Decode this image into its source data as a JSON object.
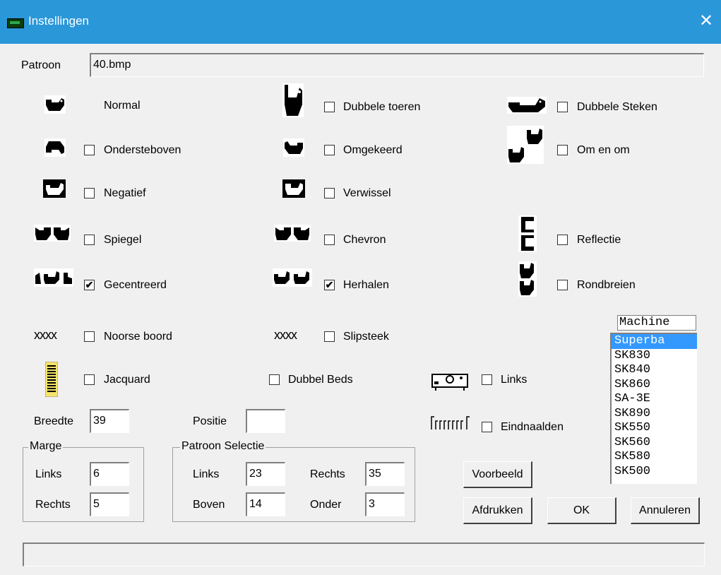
{
  "window": {
    "title": "Instellingen",
    "close": "✕"
  },
  "patroon": {
    "label": "Patroon",
    "value": "40.bmp"
  },
  "options": {
    "normal": {
      "label": "Normal"
    },
    "dubbele_toeren": {
      "label": "Dubbele toeren",
      "checked": false
    },
    "dubbele_steken": {
      "label": "Dubbele Steken",
      "checked": false
    },
    "ondersteboven": {
      "label": "Ondersteboven",
      "checked": false
    },
    "omgekeerd": {
      "label": "Omgekeerd",
      "checked": false
    },
    "om_en_om": {
      "label": "Om en om",
      "checked": false
    },
    "negatief": {
      "label": "Negatief",
      "checked": false
    },
    "verwissel": {
      "label": "Verwissel",
      "checked": false
    },
    "spiegel": {
      "label": "Spiegel",
      "checked": false
    },
    "chevron": {
      "label": "Chevron",
      "checked": false
    },
    "reflectie": {
      "label": "Reflectie",
      "checked": false
    },
    "gecentreerd": {
      "label": "Gecentreerd",
      "checked": true,
      "mark": "✔"
    },
    "herhalen": {
      "label": "Herhalen",
      "checked": true,
      "mark": "✔"
    },
    "rondbreien": {
      "label": "Rondbreien",
      "checked": false
    },
    "noorse_boord": {
      "label": "Noorse boord",
      "checked": false,
      "icon_text": "xxxx"
    },
    "slipsteek": {
      "label": "Slipsteek",
      "checked": false,
      "icon_text": "xxxx"
    },
    "jacquard": {
      "label": "Jacquard",
      "checked": false
    },
    "dubbel_beds": {
      "label": "Dubbel Beds",
      "checked": false
    },
    "links": {
      "label": "Links",
      "checked": false
    },
    "eindnaalden": {
      "label": "Eindnaalden",
      "checked": false
    }
  },
  "breedte": {
    "label": "Breedte",
    "value": "39"
  },
  "positie": {
    "label": "Positie",
    "value": ""
  },
  "marge": {
    "title": "Marge",
    "links_label": "Links",
    "links_value": "6",
    "rechts_label": "Rechts",
    "rechts_value": "5"
  },
  "selectie": {
    "title": "Patroon Selectie",
    "links_label": "Links",
    "links_value": "23",
    "rechts_label": "Rechts",
    "rechts_value": "35",
    "boven_label": "Boven",
    "boven_value": "14",
    "onder_label": "Onder",
    "onder_value": "3"
  },
  "machine": {
    "header": "Machine",
    "items": [
      "Superba",
      "SK830",
      "SK840",
      "SK860",
      "SA-3E",
      "SK890",
      "SK550",
      "SK560",
      "SK580",
      "SK500"
    ],
    "selected": "Superba"
  },
  "buttons": {
    "voorbeeld": "Voorbeeld",
    "afdrukken": "Afdrukken",
    "ok": "OK",
    "annuleren": "Annuleren"
  },
  "status": {
    "text": ""
  },
  "colors": {
    "titlebar": "#2a97d9",
    "selection": "#3399ff",
    "face": "#f0f0f0"
  }
}
